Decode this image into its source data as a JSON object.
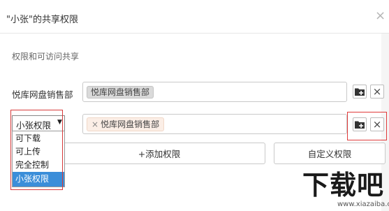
{
  "dialog": {
    "title": "\"小张\"的共享权限",
    "close_glyph": "×"
  },
  "section_label": "权限和可访问共享",
  "rows": [
    {
      "label": "悦库网盘销售部",
      "tag": "悦库网盘销售部"
    },
    {
      "select_value": "小张权限",
      "select_arrow": "▼",
      "tag_remove": "×",
      "tag": "悦库网盘销售部"
    }
  ],
  "dropdown_options": [
    {
      "label": "可下载",
      "selected": false
    },
    {
      "label": "可上传",
      "selected": false
    },
    {
      "label": "完全控制",
      "selected": false
    },
    {
      "label": "小张权限",
      "selected": true
    }
  ],
  "buttons": {
    "add_permission": "+添加权限",
    "custom_permission": "自定义权限"
  },
  "row_icons": {
    "add": "folder-add-icon",
    "remove": "close-icon",
    "remove_glyph": "×"
  },
  "watermark": {
    "text": "下载吧",
    "url": "www.xiazaiba.com"
  },
  "colors": {
    "selected_option": "#3b8ed9",
    "highlight_border": "#e03a3a",
    "tag_gray": "#dadada",
    "tag_peach": "#fbeee6"
  }
}
